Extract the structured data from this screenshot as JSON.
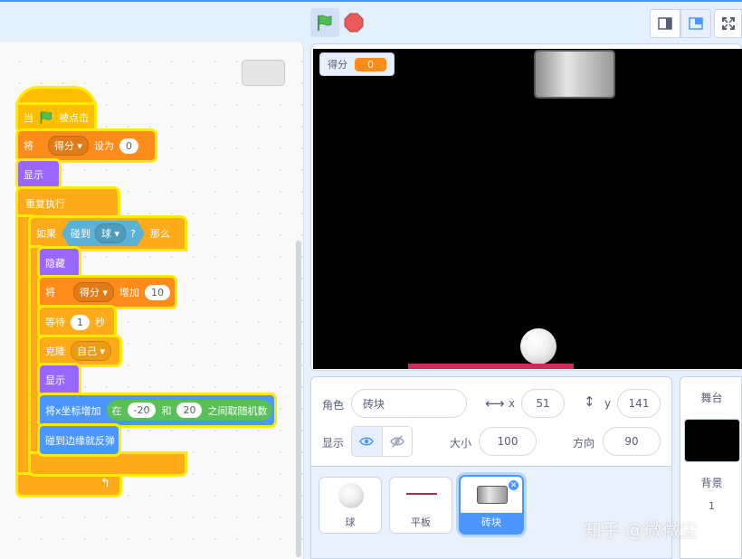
{
  "topbar": {
    "flag_icon": "green-flag-icon",
    "stop_icon": "stop-icon",
    "colors": {
      "flag": "#4cbf56",
      "stop": "#ec5959",
      "accent": "#4c97ff"
    }
  },
  "script": {
    "hat_prefix": "当",
    "hat_suffix": "被点击",
    "set_label": "将",
    "set_var": "得分",
    "set_to": "设为",
    "set_value": "0",
    "show": "显示",
    "forever": "重复执行",
    "if": "如果",
    "touching": "碰到",
    "touching_target": "球",
    "question": "?",
    "then": "那么",
    "hide": "隐藏",
    "change_label": "将",
    "change_var": "得分",
    "change_by": "增加",
    "change_value": "10",
    "wait": "等待",
    "wait_value": "1",
    "wait_unit": "秒",
    "clone": "克隆",
    "clone_target": "自己",
    "show2": "显示",
    "change_x": "将x坐标增加",
    "random_in": "在",
    "random_from": "-20",
    "random_and": "和",
    "random_to": "20",
    "random_suffix": "之间取随机数",
    "bounce": "碰到边缘就反弹"
  },
  "stage": {
    "monitor_label": "得分",
    "monitor_value": "0"
  },
  "sprite_info": {
    "sprite_label": "角色",
    "sprite_name": "砖块",
    "x_label": "x",
    "x_value": "51",
    "y_label": "y",
    "y_value": "141",
    "show_label": "显示",
    "size_label": "大小",
    "size_value": "100",
    "direction_label": "方向",
    "direction_value": "90"
  },
  "sprites": [
    {
      "name": "球"
    },
    {
      "name": "平板"
    },
    {
      "name": "砖块"
    }
  ],
  "stage_pane": {
    "title": "舞台",
    "backdrop_label": "背景",
    "backdrop_count": "1"
  },
  "watermark": "知乎 @微微尘"
}
